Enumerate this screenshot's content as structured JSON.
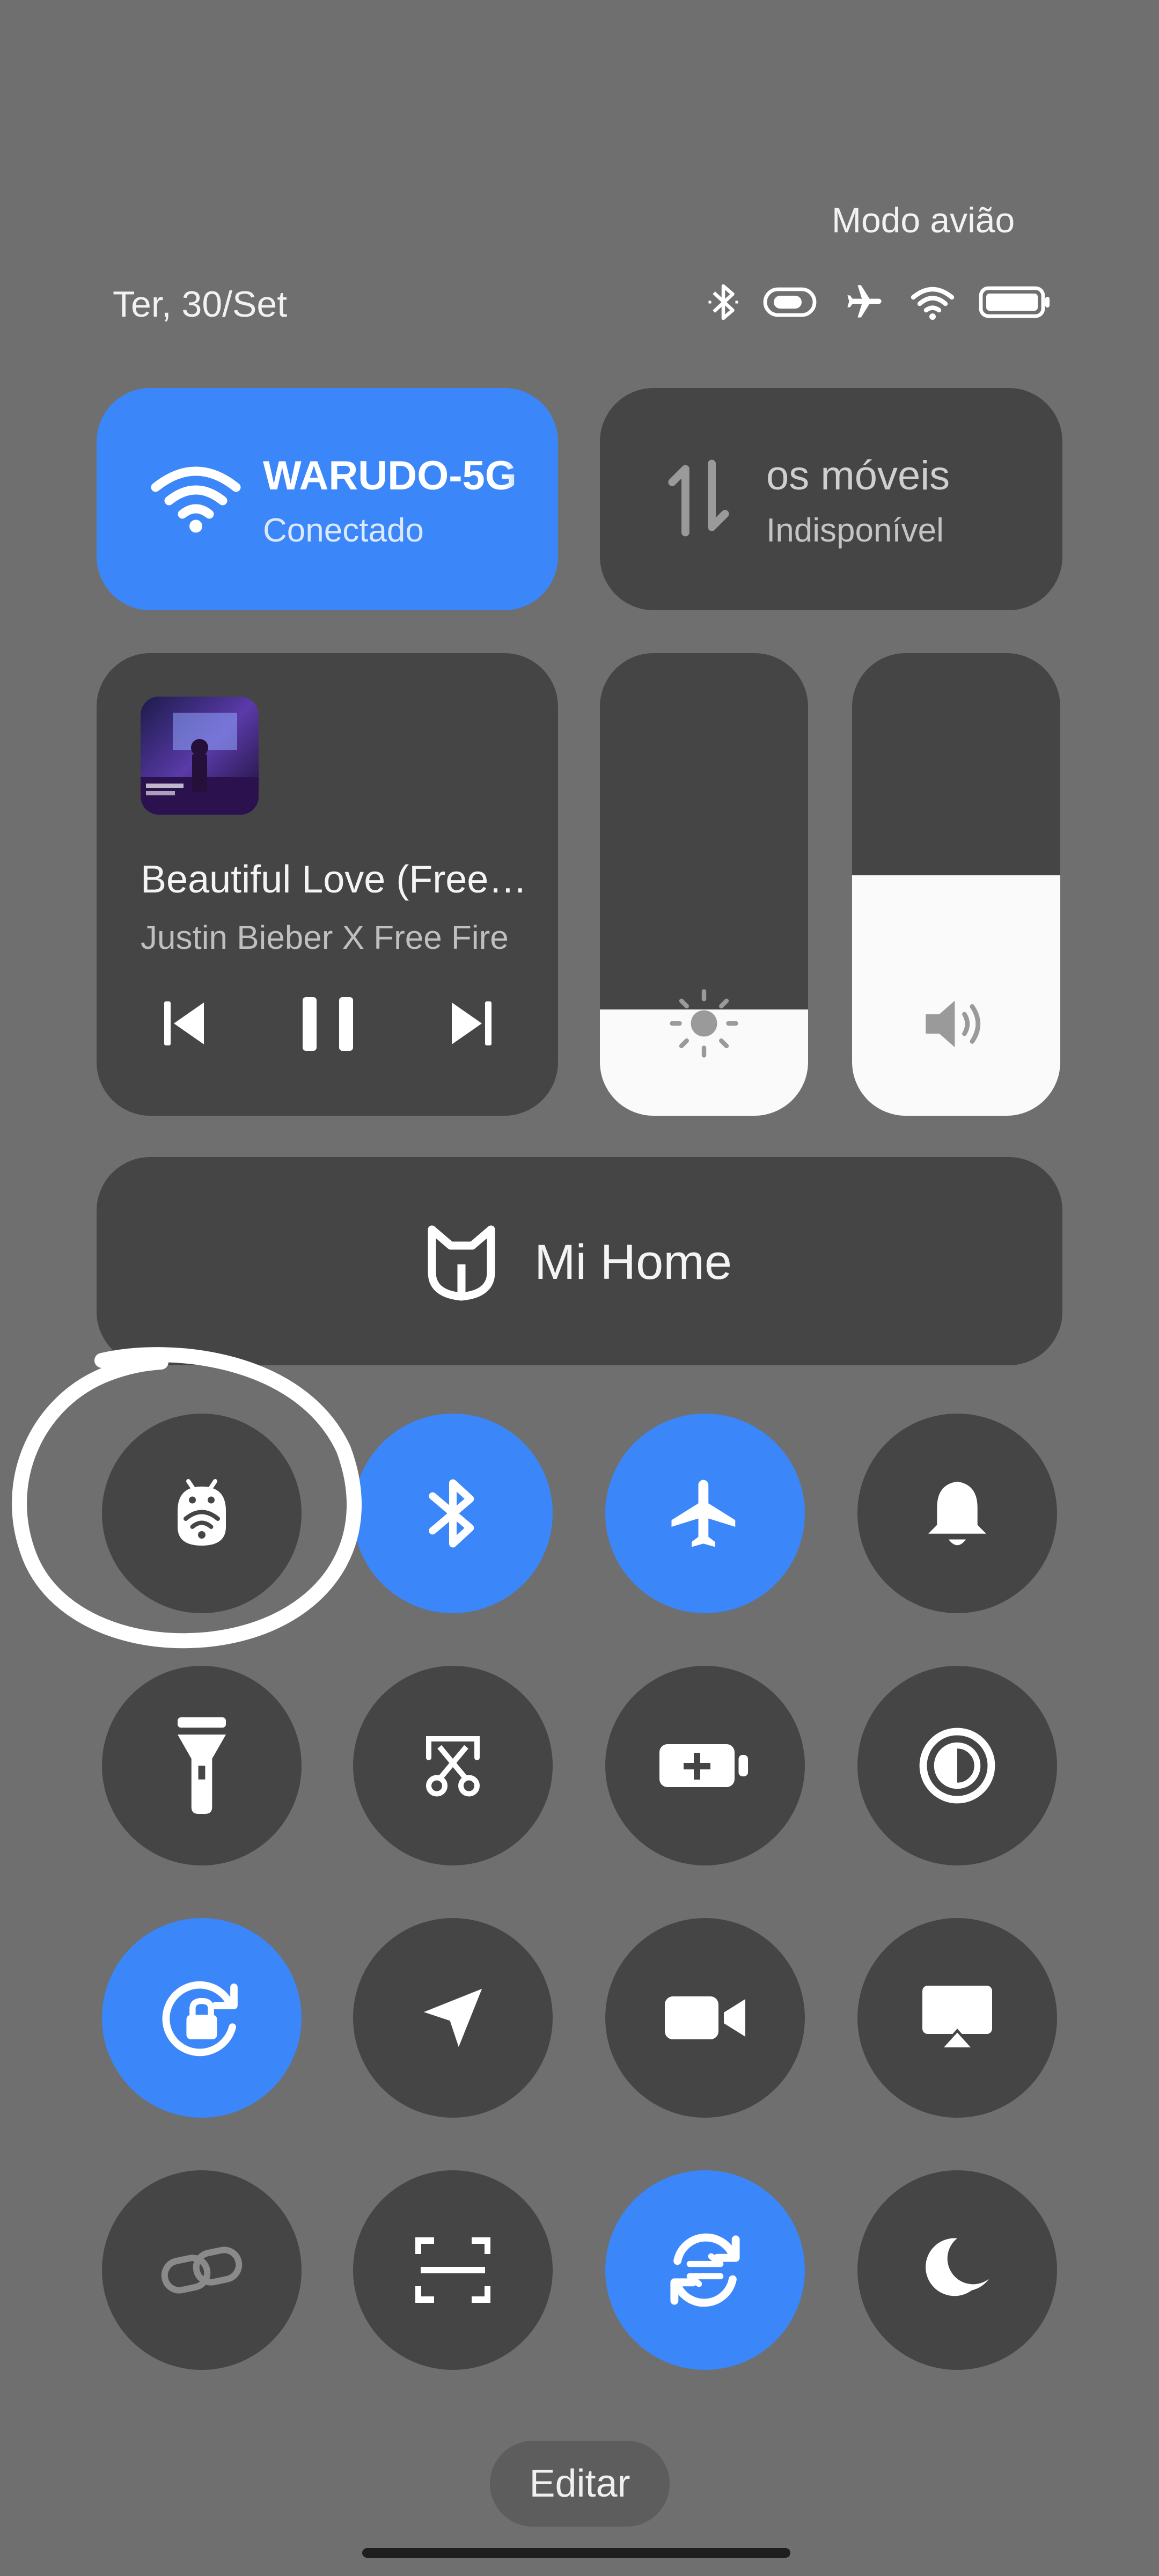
{
  "status_bar": {
    "mode_text": "Modo avião",
    "date": "Ter, 30/Set",
    "icons": [
      "bluetooth-icon",
      "toggle-icon",
      "airplane-icon",
      "wifi-icon",
      "battery-icon"
    ]
  },
  "wifi_tile": {
    "title": "WARUDO-5G",
    "subtitle": "Conectado",
    "icon": "wifi-icon"
  },
  "mobile_tile": {
    "title": "os móveis",
    "subtitle": "Indisponível",
    "icon": "mobile-data-icon"
  },
  "media": {
    "title": "Beautiful Love (Free…",
    "artist": "Justin Bieber X Free Fire",
    "controls": [
      "previous-icon",
      "pause-icon",
      "next-icon"
    ]
  },
  "brightness": {
    "level": 0.23,
    "icon": "sun-icon"
  },
  "volume": {
    "level": 0.52,
    "icon": "speaker-icon"
  },
  "mi_home": {
    "label": "Mi Home",
    "icon": "mi-home-icon"
  },
  "quick_toggles": [
    {
      "name": "android-wifi-toggle",
      "icon": "android-wifi-icon",
      "active": false
    },
    {
      "name": "bluetooth-toggle",
      "icon": "bluetooth-icon",
      "active": true
    },
    {
      "name": "airplane-mode-toggle",
      "icon": "airplane-icon",
      "active": true
    },
    {
      "name": "sound-toggle",
      "icon": "bell-icon",
      "active": false
    },
    {
      "name": "flashlight-toggle",
      "icon": "flashlight-icon",
      "active": false
    },
    {
      "name": "screenshot-toggle",
      "icon": "scissors-icon",
      "active": false
    },
    {
      "name": "battery-saver-toggle",
      "icon": "battery-plus-icon",
      "active": false
    },
    {
      "name": "reading-mode-toggle",
      "icon": "contrast-icon",
      "active": false
    },
    {
      "name": "rotation-lock-toggle",
      "icon": "rotation-lock-icon",
      "active": true
    },
    {
      "name": "location-toggle",
      "icon": "location-arrow-icon",
      "active": false
    },
    {
      "name": "video-toggle",
      "icon": "video-camera-icon",
      "active": false
    },
    {
      "name": "cast-toggle",
      "icon": "cast-icon",
      "active": false
    },
    {
      "name": "link-toggle",
      "icon": "link-icon",
      "active": false
    },
    {
      "name": "scanner-toggle",
      "icon": "scan-icon",
      "active": false
    },
    {
      "name": "sync-toggle",
      "icon": "sync-icon",
      "active": true
    },
    {
      "name": "dark-mode-toggle",
      "icon": "moon-icon",
      "active": false
    }
  ],
  "edit_button": {
    "label": "Editar"
  },
  "colors": {
    "accent": "#3b86f9",
    "tile": "#454545",
    "background": "#6f6f6f"
  }
}
